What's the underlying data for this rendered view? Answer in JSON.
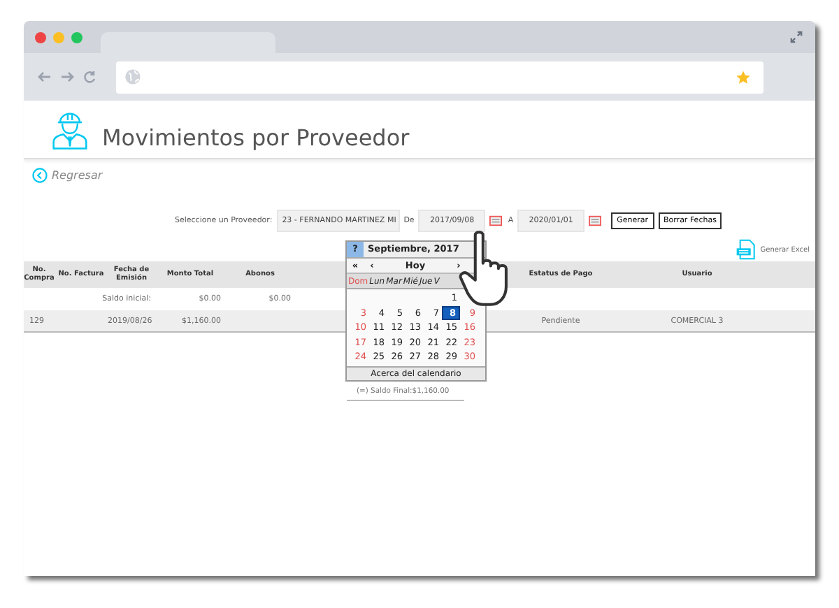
{
  "page": {
    "title": "Movimientos por Proveedor",
    "back_link": "Regresar"
  },
  "filters": {
    "supplier_label": "Seleccione un Proveedor:",
    "supplier": "23 - FERNANDO MARTINEZ MI",
    "from_label": "De",
    "from": "2017/09/08",
    "to_label": "A",
    "to": "2020/01/01",
    "buttons": [
      "Generar",
      "Borrar Fechas"
    ]
  },
  "export_link": "Generar Excel",
  "table": {
    "columns": [
      "No. Compra",
      "No. Factura",
      "Fecha de Emisión",
      "Monto Total",
      "Abonos",
      "Estatus de Pago",
      "Usuario"
    ],
    "opening_row": {
      "label": "Saldo inicial:",
      "total": "$0.00",
      "payments": "$0.00"
    },
    "rows": [
      {
        "purchase": "129",
        "date": "2019/08/26",
        "total": "$1,160.00",
        "status": "Pendiente",
        "user": "COMERCIAL 3"
      }
    ],
    "closing": "(=) Saldo Final:$1,160.00"
  },
  "calendar": {
    "help": "?",
    "month": "Septiembre, 2017",
    "nav": [
      "«",
      "‹",
      "Hoy",
      "›"
    ],
    "weekdays": [
      {
        "label": "Dom",
        "weekend": true
      },
      {
        "label": "Lun",
        "weekend": false
      },
      {
        "label": "Mar",
        "weekend": false
      },
      {
        "label": "Mié",
        "weekend": false
      },
      {
        "label": "Jue",
        "weekend": false
      },
      {
        "label": "V",
        "weekend": false
      }
    ],
    "weeks": [
      [
        {
          "kind": "empty"
        },
        {
          "kind": "empty"
        },
        {
          "kind": "empty"
        },
        {
          "kind": "empty"
        },
        {
          "kind": "empty"
        },
        {
          "kind": "day",
          "day": "1",
          "weekend": false,
          "selected": false
        },
        {
          "kind": "empty"
        }
      ],
      [
        {
          "day": "3",
          "weekend": true,
          "selected": false
        },
        {
          "day": "4",
          "weekend": false,
          "selected": false
        },
        {
          "day": "5",
          "weekend": false,
          "selected": false
        },
        {
          "day": "6",
          "weekend": false,
          "selected": false
        },
        {
          "day": "7",
          "weekend": false,
          "selected": false
        },
        {
          "day": "8",
          "weekend": false,
          "selected": true
        },
        {
          "day": "9",
          "weekend": true,
          "selected": false
        }
      ],
      [
        {
          "day": "10",
          "weekend": true,
          "selected": false
        },
        {
          "day": "11",
          "weekend": false,
          "selected": false
        },
        {
          "day": "12",
          "weekend": false,
          "selected": false
        },
        {
          "day": "13",
          "weekend": false,
          "selected": false
        },
        {
          "day": "14",
          "weekend": false,
          "selected": false
        },
        {
          "day": "15",
          "weekend": false,
          "selected": false
        },
        {
          "day": "16",
          "weekend": true,
          "selected": false
        }
      ],
      [
        {
          "day": "17",
          "weekend": true,
          "selected": false
        },
        {
          "day": "18",
          "weekend": false,
          "selected": false
        },
        {
          "day": "19",
          "weekend": false,
          "selected": false
        },
        {
          "day": "20",
          "weekend": false,
          "selected": false
        },
        {
          "day": "21",
          "weekend": false,
          "selected": false
        },
        {
          "day": "22",
          "weekend": false,
          "selected": false
        },
        {
          "day": "23",
          "weekend": true,
          "selected": false
        }
      ],
      [
        {
          "day": "24",
          "weekend": true,
          "selected": false
        },
        {
          "day": "25",
          "weekend": false,
          "selected": false
        },
        {
          "day": "26",
          "weekend": false,
          "selected": false
        },
        {
          "day": "27",
          "weekend": false,
          "selected": false
        },
        {
          "day": "28",
          "weekend": false,
          "selected": false
        },
        {
          "day": "29",
          "weekend": false,
          "selected": false
        },
        {
          "day": "30",
          "weekend": true,
          "selected": false
        }
      ]
    ],
    "about": "Acerca del calendario"
  }
}
